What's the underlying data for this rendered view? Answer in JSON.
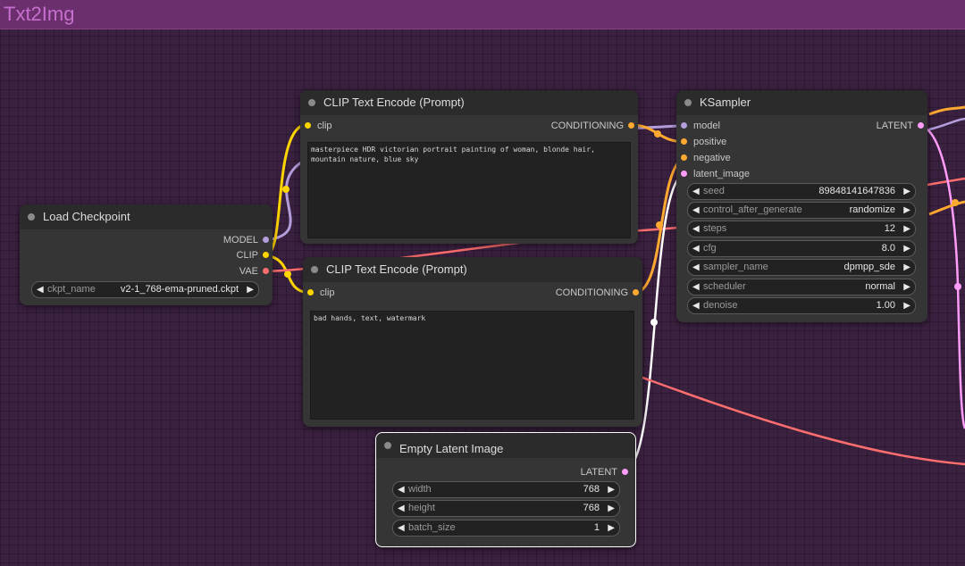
{
  "group": {
    "title": "Txt2Img"
  },
  "colors": {
    "model_slot": "#b39ddb",
    "clip_slot": "#ffd500",
    "vae_slot": "#ff6e6e",
    "conditioning_slot": "#ffa931",
    "latent_slot": "#ff9cf9",
    "selected_outline": "#ffffff"
  },
  "nodes": {
    "load_checkpoint": {
      "title": "Load Checkpoint",
      "outputs": [
        "MODEL",
        "CLIP",
        "VAE"
      ],
      "widgets": [
        {
          "label": "ckpt_name",
          "value": "v2-1_768-ema-pruned.ckpt"
        }
      ]
    },
    "clip_pos": {
      "title": "CLIP Text Encode (Prompt)",
      "input": "clip",
      "output": "CONDITIONING",
      "text": "masterpiece HDR victorian portrait painting of woman, blonde hair, mountain nature, blue sky"
    },
    "clip_neg": {
      "title": "CLIP Text Encode (Prompt)",
      "input": "clip",
      "output": "CONDITIONING",
      "text": "bad hands, text, watermark"
    },
    "ksampler": {
      "title": "KSampler",
      "inputs": [
        "model",
        "positive",
        "negative",
        "latent_image"
      ],
      "output": "LATENT",
      "widgets": [
        {
          "label": "seed",
          "value": "89848141647836"
        },
        {
          "label": "control_after_generate",
          "value": "randomize"
        },
        {
          "label": "steps",
          "value": "12"
        },
        {
          "label": "cfg",
          "value": "8.0"
        },
        {
          "label": "sampler_name",
          "value": "dpmpp_sde"
        },
        {
          "label": "scheduler",
          "value": "normal"
        },
        {
          "label": "denoise",
          "value": "1.00"
        }
      ]
    },
    "empty_latent": {
      "title": "Empty Latent Image",
      "output": "LATENT",
      "widgets": [
        {
          "label": "width",
          "value": "768"
        },
        {
          "label": "height",
          "value": "768"
        },
        {
          "label": "batch_size",
          "value": "1"
        }
      ]
    }
  },
  "icons": {
    "decrement": "◀",
    "increment": "▶"
  }
}
